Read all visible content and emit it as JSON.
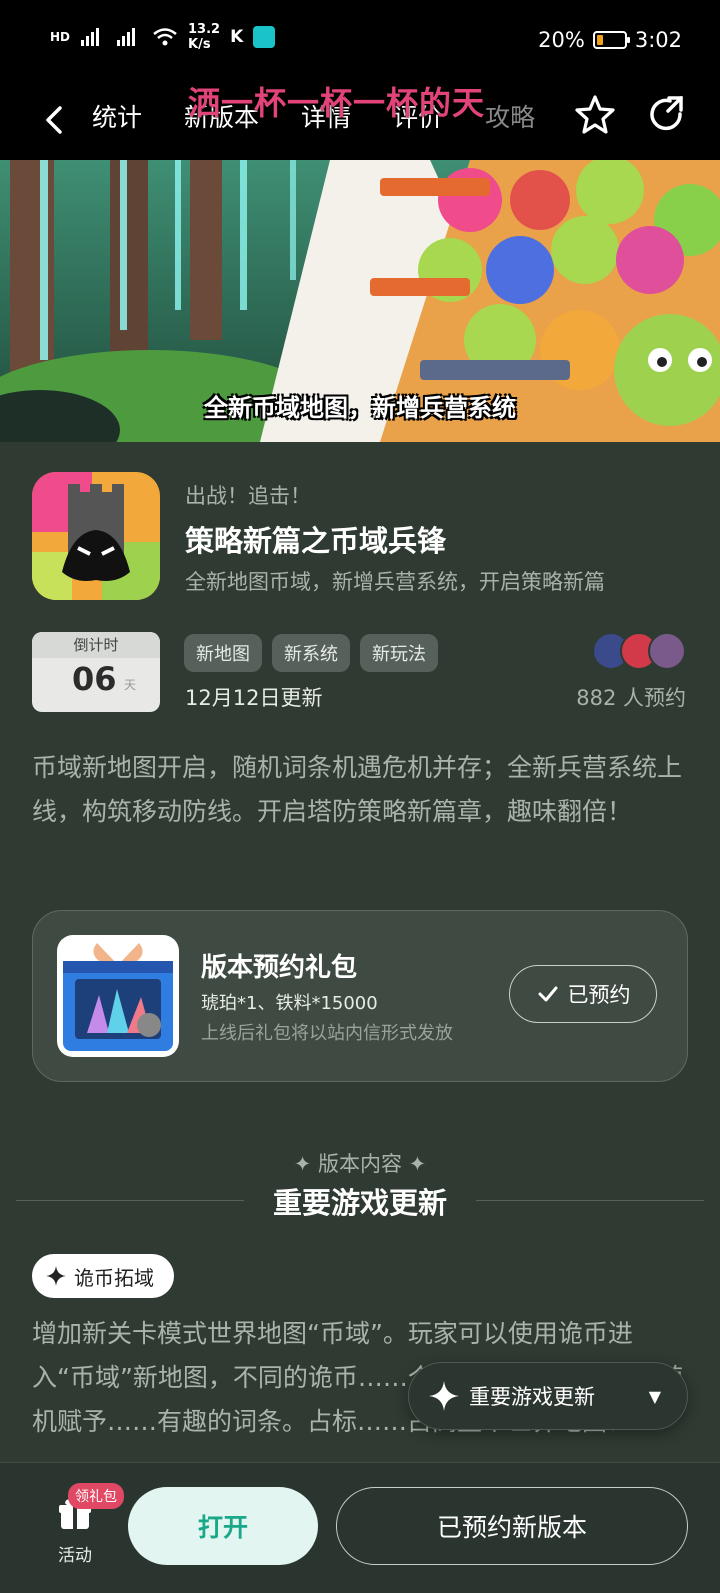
{
  "status_bar": {
    "network_left": "HD",
    "speed": "13.2",
    "speed_unit": "K/s",
    "battery_percent": "20%",
    "time": "3:02"
  },
  "nav": {
    "tabs": [
      {
        "label": "统计"
      },
      {
        "label": "新版本"
      },
      {
        "label": "详情"
      },
      {
        "label": "评价"
      },
      {
        "label": "攻略"
      }
    ],
    "danmaku": "洒一杯一杯一杯的天"
  },
  "banner": {
    "caption": "全新币域地图，新增兵营系统"
  },
  "header": {
    "kicker": "出战！追击！",
    "title": "策略新篇之币域兵锋",
    "subtitle": "全新地图币域，新增兵营系统，开启策略新篇"
  },
  "countdown": {
    "label": "倒计时",
    "value": "06",
    "unit": "天"
  },
  "tags": [
    "新地图",
    "新系统",
    "新玩法"
  ],
  "update_date": "12月12日更新",
  "reserve_count": "882 人预约",
  "description": "币域新地图开启，随机词条机遇危机并存；全新兵营系统上线，构筑移动防线。开启塔防策略新篇章，趣味翻倍！",
  "gift": {
    "title": "版本预约礼包",
    "items": "琥珀*1、铁料*15000",
    "note": "上线后礼包将以站内信形式发放",
    "button": "已预约"
  },
  "content": {
    "section_label": "✦ 版本内容 ✦",
    "section_title": "重要游戏更新",
    "chip_label": "诡币拓域",
    "body": "增加新关卡模式世界地图“币域”。玩家可以使用诡币进入“币域”新地图，不同的诡币……个关卡根据稀有度会被随机赋予……有趣的词条。占标……占高整个世界地图！"
  },
  "floating_pill": {
    "label": "重要游戏更新"
  },
  "bottom_bar": {
    "activity_label": "活动",
    "gift_badge": "领礼包",
    "open_button": "打开",
    "reserved_button": "已预约新版本"
  },
  "colors": {
    "background": "#2f3a32",
    "accent": "#1ec7a4",
    "danmaku": "#e2447a",
    "badge": "#e04863"
  }
}
